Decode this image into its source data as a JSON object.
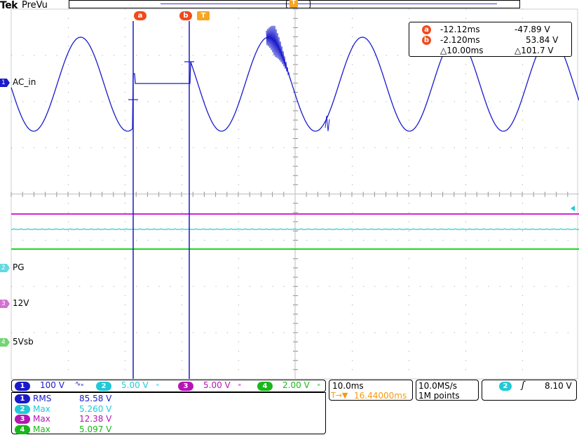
{
  "header": {
    "brand": "Tek",
    "mode": "PreVu"
  },
  "markers": {
    "cursor_a": "a",
    "cursor_b": "b",
    "trigger": "T"
  },
  "cursor_readout": {
    "a_time": "-12.12ms",
    "a_value": "-47.89 V",
    "b_time": "-2.120ms",
    "b_value": "53.84 V",
    "delta_time": "△10.00ms",
    "delta_value": "△101.7 V"
  },
  "channel_labels": {
    "ch1": "AC_in",
    "ch2": "PG",
    "ch3": "12V",
    "ch4": "5Vsb"
  },
  "channel_settings": [
    {
      "num": "1",
      "scale": "100 V",
      "coupling": "∿ₑ",
      "color": "#1a1acc"
    },
    {
      "num": "2",
      "scale": "5.00 V",
      "coupling": "ₑ",
      "color": "#21c9d6"
    },
    {
      "num": "3",
      "scale": "5.00 V",
      "coupling": "ₑ",
      "color": "#b515b5"
    },
    {
      "num": "4",
      "scale": "2.00 V",
      "coupling": "ₑ",
      "color": "#18b818"
    }
  ],
  "measurements": [
    {
      "num": "1",
      "label": "RMS",
      "value": "85.58 V",
      "color": "#1a1acc"
    },
    {
      "num": "2",
      "label": "Max",
      "value": "5.260 V",
      "color": "#21c9d6"
    },
    {
      "num": "3",
      "label": "Max",
      "value": "12.38 V",
      "color": "#b515b5"
    },
    {
      "num": "4",
      "label": "Max",
      "value": "5.097 V",
      "color": "#18b818"
    }
  ],
  "timebase": {
    "scale": "10.0ms",
    "trigger_position": "16.44000ms",
    "trigger_prefix": "T→▼"
  },
  "acquisition": {
    "sample_rate": "10.0MS/s",
    "record_length": "1M points"
  },
  "trigger": {
    "source": "2",
    "slope": "ʃ",
    "level": "8.10 V"
  },
  "colors": {
    "ch1": "#1a1acc",
    "ch2": "#21c9d6",
    "ch3": "#d426d4",
    "ch4": "#1fd61f",
    "cursor_a": "#f04a1c",
    "cursor_b": "#f04a1c",
    "trigger_marker": "#f5a623",
    "timebase_accent": "#f59b12"
  }
}
